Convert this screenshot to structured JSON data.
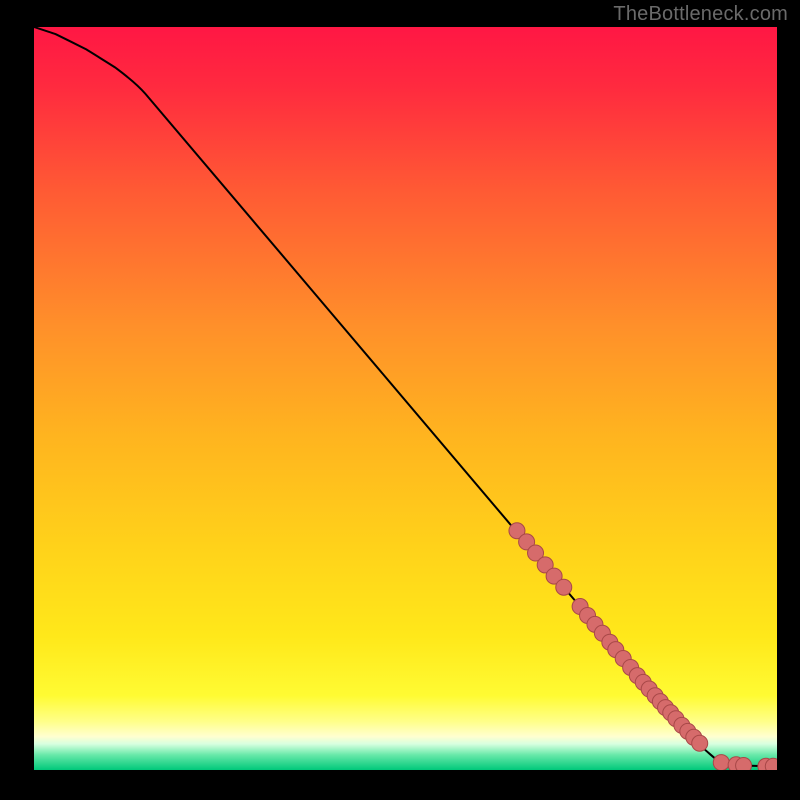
{
  "watermark": "TheBottleneck.com",
  "colors": {
    "marker_fill": "#d66b6b",
    "marker_stroke": "#a84848",
    "line": "#000000",
    "gradient_stops": [
      {
        "offset": 0.0,
        "color": "#ff1744"
      },
      {
        "offset": 0.08,
        "color": "#ff2a3f"
      },
      {
        "offset": 0.22,
        "color": "#ff5a34"
      },
      {
        "offset": 0.4,
        "color": "#ff8f2a"
      },
      {
        "offset": 0.55,
        "color": "#ffb41f"
      },
      {
        "offset": 0.7,
        "color": "#ffd21a"
      },
      {
        "offset": 0.82,
        "color": "#ffe81a"
      },
      {
        "offset": 0.9,
        "color": "#fffb33"
      },
      {
        "offset": 0.935,
        "color": "#ffff8a"
      },
      {
        "offset": 0.955,
        "color": "#ffffd0"
      },
      {
        "offset": 0.965,
        "color": "#d7ffe0"
      },
      {
        "offset": 0.98,
        "color": "#66e8a8"
      },
      {
        "offset": 1.0,
        "color": "#00c87a"
      }
    ]
  },
  "chart_data": {
    "type": "line",
    "title": "",
    "xlabel": "",
    "ylabel": "",
    "xlim": [
      0,
      100
    ],
    "ylim": [
      0,
      100
    ],
    "curve": [
      {
        "x": 0,
        "y": 100
      },
      {
        "x": 3,
        "y": 99
      },
      {
        "x": 7,
        "y": 97
      },
      {
        "x": 11,
        "y": 94.5
      },
      {
        "x": 15,
        "y": 91
      },
      {
        "x": 65,
        "y": 32
      },
      {
        "x": 82,
        "y": 12
      },
      {
        "x": 87,
        "y": 6
      },
      {
        "x": 90,
        "y": 3
      },
      {
        "x": 92,
        "y": 1.3
      },
      {
        "x": 96,
        "y": 0.6
      },
      {
        "x": 100,
        "y": 0.5
      }
    ],
    "markers": [
      {
        "x": 65.0,
        "y": 32.2
      },
      {
        "x": 66.3,
        "y": 30.7
      },
      {
        "x": 67.5,
        "y": 29.2
      },
      {
        "x": 68.8,
        "y": 27.6
      },
      {
        "x": 70.0,
        "y": 26.1
      },
      {
        "x": 71.3,
        "y": 24.6
      },
      {
        "x": 73.5,
        "y": 22.0
      },
      {
        "x": 74.5,
        "y": 20.8
      },
      {
        "x": 75.5,
        "y": 19.6
      },
      {
        "x": 76.5,
        "y": 18.4
      },
      {
        "x": 77.5,
        "y": 17.2
      },
      {
        "x": 78.3,
        "y": 16.2
      },
      {
        "x": 79.3,
        "y": 15.0
      },
      {
        "x": 80.3,
        "y": 13.8
      },
      {
        "x": 81.2,
        "y": 12.7
      },
      {
        "x": 82.0,
        "y": 11.8
      },
      {
        "x": 82.8,
        "y": 10.9
      },
      {
        "x": 83.6,
        "y": 10.0
      },
      {
        "x": 84.3,
        "y": 9.2
      },
      {
        "x": 85.0,
        "y": 8.4
      },
      {
        "x": 85.7,
        "y": 7.7
      },
      {
        "x": 86.4,
        "y": 6.9
      },
      {
        "x": 87.2,
        "y": 6.0
      },
      {
        "x": 88.0,
        "y": 5.2
      },
      {
        "x": 88.8,
        "y": 4.4
      },
      {
        "x": 89.6,
        "y": 3.6
      },
      {
        "x": 92.5,
        "y": 1.0
      },
      {
        "x": 94.5,
        "y": 0.7
      },
      {
        "x": 95.5,
        "y": 0.6
      },
      {
        "x": 98.5,
        "y": 0.5
      },
      {
        "x": 99.5,
        "y": 0.5
      }
    ]
  }
}
